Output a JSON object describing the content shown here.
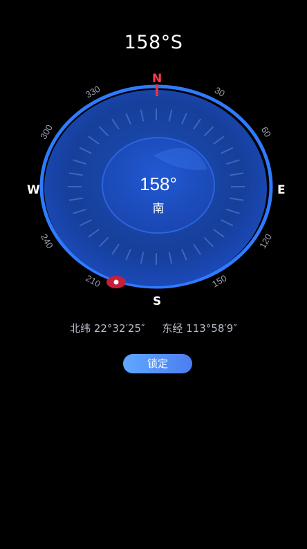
{
  "header": {
    "heading_text": "158°S"
  },
  "compass": {
    "center_degree": "158°",
    "center_direction": "南",
    "cardinals": {
      "north": "N",
      "east": "E",
      "south": "S",
      "west": "W"
    },
    "degree_labels": [
      {
        "label": "30",
        "angle": 30
      },
      {
        "label": "60",
        "angle": 60
      },
      {
        "label": "120",
        "angle": 120
      },
      {
        "label": "150",
        "angle": 150
      },
      {
        "label": "210",
        "angle": 210
      },
      {
        "label": "240",
        "angle": 240
      },
      {
        "label": "300",
        "angle": 300
      },
      {
        "label": "330",
        "angle": 330
      }
    ],
    "heading_angle": 158,
    "accent_color": "#2b6cf5",
    "north_color": "#e8323f",
    "pointer_color": "#c4203a"
  },
  "location": {
    "latitude": "北纬 22°32′25″",
    "longitude": "东经 113°58′9″"
  },
  "lock_button": {
    "label": "锁定"
  }
}
